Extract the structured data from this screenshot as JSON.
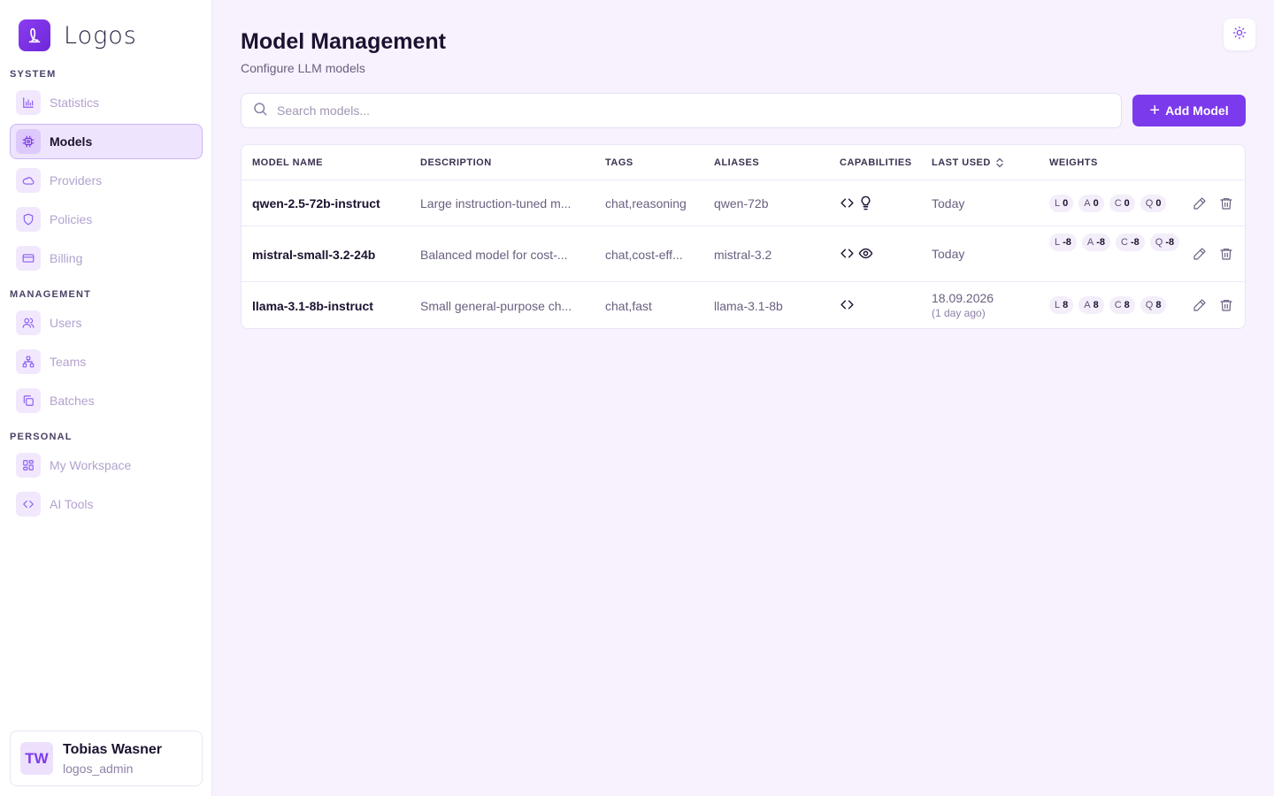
{
  "app": {
    "name": "Logos"
  },
  "sidebar": {
    "sections": [
      {
        "label": "SYSTEM",
        "items": [
          {
            "label": "Statistics",
            "icon": "bar-chart-icon",
            "active": false
          },
          {
            "label": "Models",
            "icon": "cpu-icon",
            "active": true
          },
          {
            "label": "Providers",
            "icon": "cloud-icon",
            "active": false
          },
          {
            "label": "Policies",
            "icon": "shield-icon",
            "active": false
          },
          {
            "label": "Billing",
            "icon": "credit-card-icon",
            "active": false
          }
        ]
      },
      {
        "label": "MANAGEMENT",
        "items": [
          {
            "label": "Users",
            "icon": "users-icon",
            "active": false
          },
          {
            "label": "Teams",
            "icon": "network-icon",
            "active": false
          },
          {
            "label": "Batches",
            "icon": "copy-icon",
            "active": false
          }
        ]
      },
      {
        "label": "PERSONAL",
        "items": [
          {
            "label": "My Workspace",
            "icon": "grid-icon",
            "active": false
          },
          {
            "label": "AI Tools",
            "icon": "code-icon",
            "active": false
          }
        ]
      }
    ]
  },
  "user": {
    "initials": "TW",
    "name": "Tobias Wasner",
    "handle": "logos_admin"
  },
  "main": {
    "title": "Model Management",
    "subtitle": "Configure LLM models",
    "search_placeholder": "Search models...",
    "add_button_label": "Add Model"
  },
  "table": {
    "headers": {
      "name": "MODEL NAME",
      "description": "DESCRIPTION",
      "tags": "TAGS",
      "aliases": "ALIASES",
      "capabilities": "CAPABILITIES",
      "last_used": "LAST USED",
      "weights": "WEIGHTS"
    },
    "rows": [
      {
        "name": "qwen-2.5-72b-instruct",
        "description": "Large instruction-tuned m...",
        "tags": "chat,reasoning",
        "aliases": "qwen-72b",
        "capabilities": [
          "code-icon",
          "lightbulb-icon"
        ],
        "last_used": "Today",
        "last_used_sub": "",
        "weights": [
          {
            "k": "L",
            "v": "0"
          },
          {
            "k": "A",
            "v": "0"
          },
          {
            "k": "C",
            "v": "0"
          },
          {
            "k": "Q",
            "v": "0"
          }
        ]
      },
      {
        "name": "mistral-small-3.2-24b",
        "description": "Balanced model for cost-...",
        "tags": "chat,cost-eff...",
        "aliases": "mistral-3.2",
        "capabilities": [
          "code-icon",
          "eye-icon"
        ],
        "last_used": "Today",
        "last_used_sub": "",
        "weights": [
          {
            "k": "L",
            "v": "-8"
          },
          {
            "k": "A",
            "v": "-8"
          },
          {
            "k": "C",
            "v": "-8"
          },
          {
            "k": "Q",
            "v": "-8"
          }
        ]
      },
      {
        "name": "llama-3.1-8b-instruct",
        "description": "Small general-purpose ch...",
        "tags": "chat,fast",
        "aliases": "llama-3.1-8b",
        "capabilities": [
          "code-icon"
        ],
        "last_used": "18.09.2026",
        "last_used_sub": "(1 day ago)",
        "weights": [
          {
            "k": "L",
            "v": "8"
          },
          {
            "k": "A",
            "v": "8"
          },
          {
            "k": "C",
            "v": "8"
          },
          {
            "k": "Q",
            "v": "8"
          }
        ]
      }
    ]
  },
  "colors": {
    "accent": "#7c3aed",
    "background": "#f7f2fd"
  }
}
